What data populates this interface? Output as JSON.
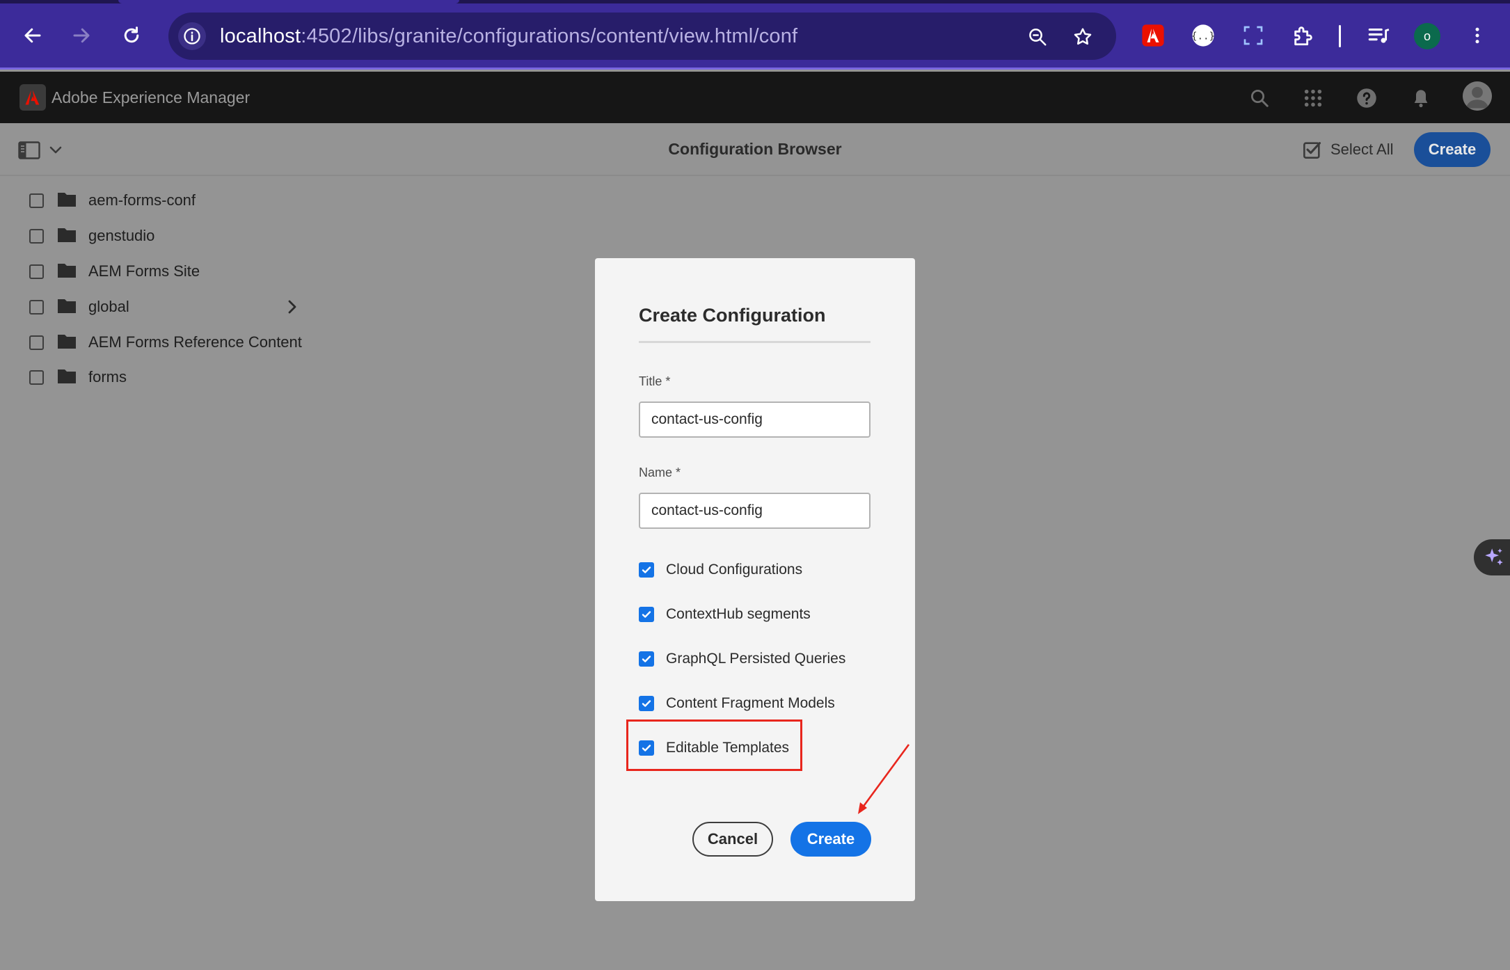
{
  "browser": {
    "url_host": "localhost",
    "url_path": ":4502/libs/granite/configurations/content/view.html/conf",
    "profile_initial": "o",
    "icons": [
      "back-icon",
      "forward-icon",
      "reload-icon",
      "info-icon",
      "zoom-icon",
      "star-icon",
      "adobe-extension-icon",
      "json-extension-icon",
      "screenshot-extension-icon",
      "puzzle-extension-icon",
      "media-control-icon",
      "kebab-menu-icon"
    ]
  },
  "aem_header": {
    "title": "Adobe Experience Manager"
  },
  "toolbar": {
    "page_title": "Configuration Browser",
    "select_all_label": "Select All",
    "create_label": "Create"
  },
  "list": {
    "items": [
      {
        "label": "aem-forms-conf",
        "has_children": false
      },
      {
        "label": "genstudio",
        "has_children": false
      },
      {
        "label": "AEM Forms Site",
        "has_children": false
      },
      {
        "label": "global",
        "has_children": true
      },
      {
        "label": "AEM Forms Reference Content",
        "has_children": false
      },
      {
        "label": "forms",
        "has_children": false
      }
    ]
  },
  "dialog": {
    "title": "Create Configuration",
    "title_field": {
      "label": "Title *",
      "value": "contact-us-config"
    },
    "name_field": {
      "label": "Name *",
      "value": "contact-us-config"
    },
    "options": [
      {
        "label": "Cloud Configurations",
        "checked": true
      },
      {
        "label": "ContextHub segments",
        "checked": true
      },
      {
        "label": "GraphQL Persisted Queries",
        "checked": true
      },
      {
        "label": "Content Fragment Models",
        "checked": true
      },
      {
        "label": "Editable Templates",
        "checked": true
      }
    ],
    "cancel_label": "Cancel",
    "create_label": "Create"
  },
  "colors": {
    "browser_bar": "#3c2b9a",
    "aem_header": "#161616",
    "overlay_bg": "#949494",
    "accent_blue": "#1473e6",
    "annotation_red": "#e8261d"
  }
}
